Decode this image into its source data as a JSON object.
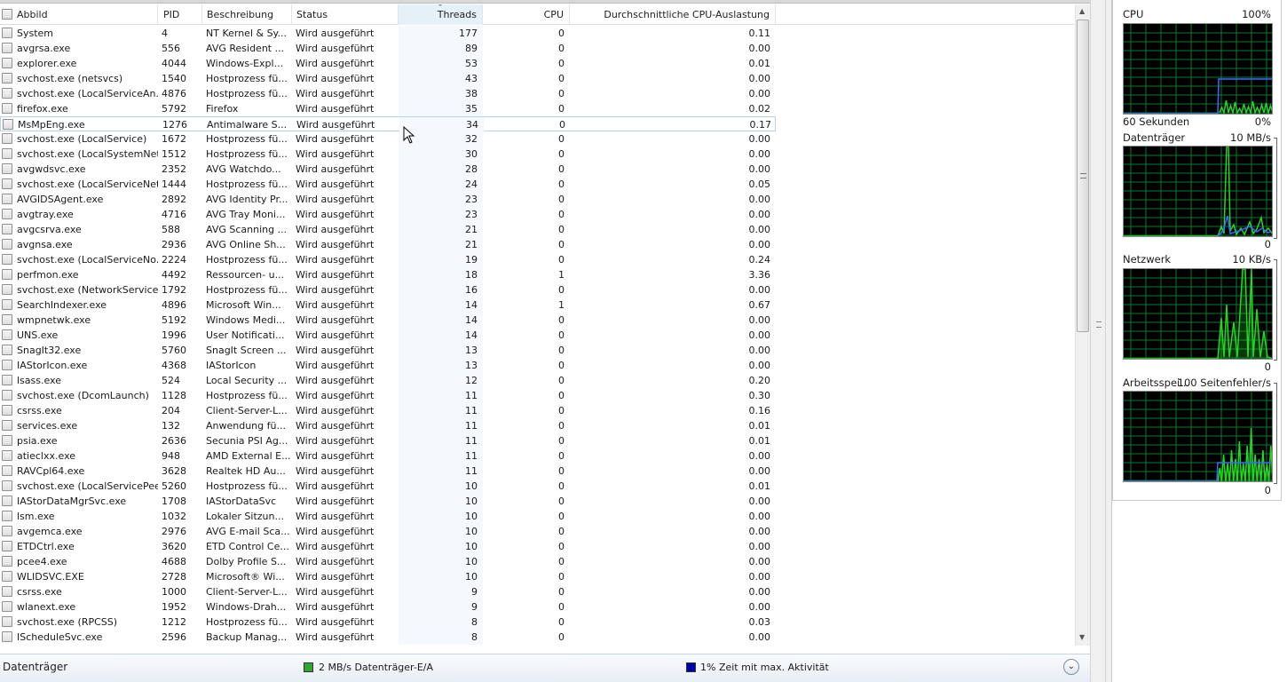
{
  "columns": {
    "abbild": "Abbild",
    "pid": "PID",
    "beschreibung": "Beschreibung",
    "status": "Status",
    "threads": "Threads",
    "cpu": "CPU",
    "avg_cpu": "Durchschnittliche CPU-Auslastung"
  },
  "processes": [
    {
      "name": "System",
      "pid": "4",
      "desc": "NT Kernel & Sy...",
      "status": "Wird ausgeführt",
      "threads": "177",
      "cpu": "0",
      "avg": "0.11"
    },
    {
      "name": "avgrsa.exe",
      "pid": "556",
      "desc": "AVG Resident ...",
      "status": "Wird ausgeführt",
      "threads": "89",
      "cpu": "0",
      "avg": "0.00"
    },
    {
      "name": "explorer.exe",
      "pid": "4044",
      "desc": "Windows-Expl...",
      "status": "Wird ausgeführt",
      "threads": "53",
      "cpu": "0",
      "avg": "0.01"
    },
    {
      "name": "svchost.exe (netsvcs)",
      "pid": "1540",
      "desc": "Hostprozess fü...",
      "status": "Wird ausgeführt",
      "threads": "43",
      "cpu": "0",
      "avg": "0.00"
    },
    {
      "name": "svchost.exe (LocalServiceAn...",
      "pid": "4876",
      "desc": "Hostprozess fü...",
      "status": "Wird ausgeführt",
      "threads": "38",
      "cpu": "0",
      "avg": "0.00"
    },
    {
      "name": "firefox.exe",
      "pid": "5792",
      "desc": "Firefox",
      "status": "Wird ausgeführt",
      "threads": "35",
      "cpu": "0",
      "avg": "0.02"
    },
    {
      "name": "MsMpEng.exe",
      "pid": "1276",
      "desc": "Antimalware S...",
      "status": "Wird ausgeführt",
      "threads": "34",
      "cpu": "0",
      "avg": "0.17"
    },
    {
      "name": "svchost.exe (LocalService)",
      "pid": "1672",
      "desc": "Hostprozess fü...",
      "status": "Wird ausgeführt",
      "threads": "32",
      "cpu": "0",
      "avg": "0.00"
    },
    {
      "name": "svchost.exe (LocalSystemNet...",
      "pid": "1512",
      "desc": "Hostprozess fü...",
      "status": "Wird ausgeführt",
      "threads": "30",
      "cpu": "0",
      "avg": "0.00"
    },
    {
      "name": "avgwdsvc.exe",
      "pid": "2352",
      "desc": "AVG Watchdo...",
      "status": "Wird ausgeführt",
      "threads": "28",
      "cpu": "0",
      "avg": "0.00"
    },
    {
      "name": "svchost.exe (LocalServiceNet...",
      "pid": "1444",
      "desc": "Hostprozess fü...",
      "status": "Wird ausgeführt",
      "threads": "24",
      "cpu": "0",
      "avg": "0.05"
    },
    {
      "name": "AVGIDSAgent.exe",
      "pid": "2892",
      "desc": "AVG Identity Pr...",
      "status": "Wird ausgeführt",
      "threads": "23",
      "cpu": "0",
      "avg": "0.00"
    },
    {
      "name": "avgtray.exe",
      "pid": "4716",
      "desc": "AVG Tray Moni...",
      "status": "Wird ausgeführt",
      "threads": "23",
      "cpu": "0",
      "avg": "0.00"
    },
    {
      "name": "avgcsrva.exe",
      "pid": "588",
      "desc": "AVG Scanning ...",
      "status": "Wird ausgeführt",
      "threads": "21",
      "cpu": "0",
      "avg": "0.00"
    },
    {
      "name": "avgnsa.exe",
      "pid": "2936",
      "desc": "AVG Online Sh...",
      "status": "Wird ausgeführt",
      "threads": "21",
      "cpu": "0",
      "avg": "0.00"
    },
    {
      "name": "svchost.exe (LocalServiceNo...",
      "pid": "2224",
      "desc": "Hostprozess fü...",
      "status": "Wird ausgeführt",
      "threads": "19",
      "cpu": "0",
      "avg": "0.24"
    },
    {
      "name": "perfmon.exe",
      "pid": "4492",
      "desc": "Ressourcen- u...",
      "status": "Wird ausgeführt",
      "threads": "18",
      "cpu": "1",
      "avg": "3.36"
    },
    {
      "name": "svchost.exe (NetworkService)",
      "pid": "1792",
      "desc": "Hostprozess fü...",
      "status": "Wird ausgeführt",
      "threads": "16",
      "cpu": "0",
      "avg": "0.00"
    },
    {
      "name": "SearchIndexer.exe",
      "pid": "4896",
      "desc": "Microsoft Win...",
      "status": "Wird ausgeführt",
      "threads": "14",
      "cpu": "1",
      "avg": "0.67"
    },
    {
      "name": "wmpnetwk.exe",
      "pid": "5192",
      "desc": "Windows Medi...",
      "status": "Wird ausgeführt",
      "threads": "14",
      "cpu": "0",
      "avg": "0.00"
    },
    {
      "name": "UNS.exe",
      "pid": "1996",
      "desc": "User Notificati...",
      "status": "Wird ausgeführt",
      "threads": "14",
      "cpu": "0",
      "avg": "0.00"
    },
    {
      "name": "SnagIt32.exe",
      "pid": "5760",
      "desc": "SnagIt Screen ...",
      "status": "Wird ausgeführt",
      "threads": "13",
      "cpu": "0",
      "avg": "0.00"
    },
    {
      "name": "IAStorIcon.exe",
      "pid": "4368",
      "desc": "IAStorIcon",
      "status": "Wird ausgeführt",
      "threads": "13",
      "cpu": "0",
      "avg": "0.00"
    },
    {
      "name": "lsass.exe",
      "pid": "524",
      "desc": "Local Security ...",
      "status": "Wird ausgeführt",
      "threads": "12",
      "cpu": "0",
      "avg": "0.20"
    },
    {
      "name": "svchost.exe (DcomLaunch)",
      "pid": "1128",
      "desc": "Hostprozess fü...",
      "status": "Wird ausgeführt",
      "threads": "11",
      "cpu": "0",
      "avg": "0.30"
    },
    {
      "name": "csrss.exe",
      "pid": "204",
      "desc": "Client-Server-L...",
      "status": "Wird ausgeführt",
      "threads": "11",
      "cpu": "0",
      "avg": "0.16"
    },
    {
      "name": "services.exe",
      "pid": "132",
      "desc": "Anwendung fü...",
      "status": "Wird ausgeführt",
      "threads": "11",
      "cpu": "0",
      "avg": "0.01"
    },
    {
      "name": "psia.exe",
      "pid": "2636",
      "desc": "Secunia PSI Ag...",
      "status": "Wird ausgeführt",
      "threads": "11",
      "cpu": "0",
      "avg": "0.01"
    },
    {
      "name": "atieclxx.exe",
      "pid": "948",
      "desc": "AMD External E...",
      "status": "Wird ausgeführt",
      "threads": "11",
      "cpu": "0",
      "avg": "0.00"
    },
    {
      "name": "RAVCpl64.exe",
      "pid": "3628",
      "desc": "Realtek HD Au...",
      "status": "Wird ausgeführt",
      "threads": "11",
      "cpu": "0",
      "avg": "0.00"
    },
    {
      "name": "svchost.exe (LocalServicePee...",
      "pid": "5260",
      "desc": "Hostprozess fü...",
      "status": "Wird ausgeführt",
      "threads": "10",
      "cpu": "0",
      "avg": "0.01"
    },
    {
      "name": "IAStorDataMgrSvc.exe",
      "pid": "1708",
      "desc": "IAStorDataSvc",
      "status": "Wird ausgeführt",
      "threads": "10",
      "cpu": "0",
      "avg": "0.00"
    },
    {
      "name": "lsm.exe",
      "pid": "1032",
      "desc": "Lokaler Sitzun...",
      "status": "Wird ausgeführt",
      "threads": "10",
      "cpu": "0",
      "avg": "0.00"
    },
    {
      "name": "avgemca.exe",
      "pid": "2976",
      "desc": "AVG E-mail Sca...",
      "status": "Wird ausgeführt",
      "threads": "10",
      "cpu": "0",
      "avg": "0.00"
    },
    {
      "name": "ETDCtrl.exe",
      "pid": "3620",
      "desc": "ETD Control Ce...",
      "status": "Wird ausgeführt",
      "threads": "10",
      "cpu": "0",
      "avg": "0.00"
    },
    {
      "name": "pcee4.exe",
      "pid": "4688",
      "desc": "Dolby Profile S...",
      "status": "Wird ausgeführt",
      "threads": "10",
      "cpu": "0",
      "avg": "0.00"
    },
    {
      "name": "WLIDSVC.EXE",
      "pid": "2728",
      "desc": "Microsoft® Wi...",
      "status": "Wird ausgeführt",
      "threads": "10",
      "cpu": "0",
      "avg": "0.00"
    },
    {
      "name": "csrss.exe",
      "pid": "1000",
      "desc": "Client-Server-L...",
      "status": "Wird ausgeführt",
      "threads": "9",
      "cpu": "0",
      "avg": "0.00"
    },
    {
      "name": "wlanext.exe",
      "pid": "1952",
      "desc": "Windows-Drah...",
      "status": "Wird ausgeführt",
      "threads": "9",
      "cpu": "0",
      "avg": "0.00"
    },
    {
      "name": "svchost.exe (RPCSS)",
      "pid": "1212",
      "desc": "Hostprozess fü...",
      "status": "Wird ausgeführt",
      "threads": "8",
      "cpu": "0",
      "avg": "0.03"
    },
    {
      "name": "IScheduleSvc.exe",
      "pid": "2596",
      "desc": "Backup Manag...",
      "status": "Wird ausgeführt",
      "threads": "8",
      "cpu": "0",
      "avg": "0.00"
    }
  ],
  "statusbar": {
    "title": "Datenträger",
    "legend1": "2 MB/s Datenträger-E/A",
    "legend1_color": "#2fa82f",
    "legend2": "1% Zeit mit max. Aktivität",
    "legend2_color": "#0000b0"
  },
  "graphs": {
    "cpu": {
      "label": "CPU",
      "max": "100%",
      "foot_left": "60 Sekunden",
      "foot_right": "0%"
    },
    "disk": {
      "label": "Datenträger",
      "max": "10 MB/s",
      "foot_right": "0"
    },
    "net": {
      "label": "Netzwerk",
      "max": "10 KB/s",
      "foot_right": "0"
    },
    "mem": {
      "label": "Arbeitsspei...",
      "max": "100 Seitenfehler/s",
      "foot_right": "0"
    }
  },
  "colors": {
    "graph_bg": "#000000",
    "graph_grid": "#0b7a32",
    "graph_green": "#26d626",
    "graph_blue": "#3a6cff",
    "selected_border": "#b8d2ec"
  }
}
